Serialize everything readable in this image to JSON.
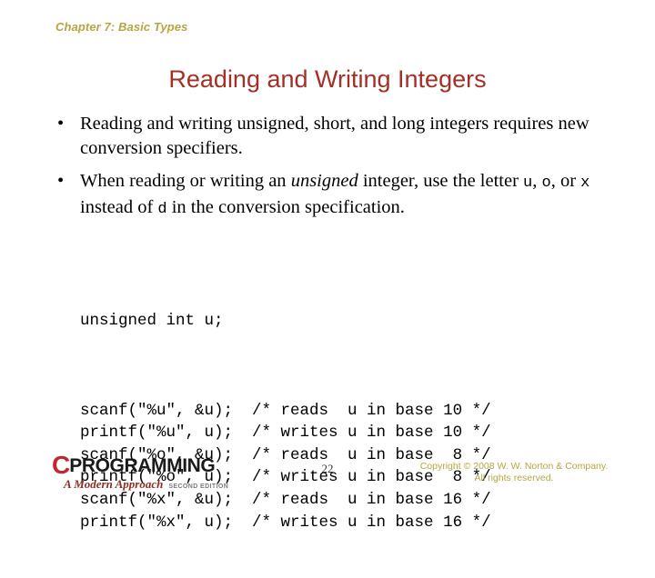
{
  "slide": {
    "chapter_header": "Chapter 7: Basic Types",
    "title": "Reading and Writing Integers",
    "bullet_marker": "•",
    "bullets": [
      {
        "parts": [
          {
            "kind": "text",
            "value": "Reading and writing unsigned, short, and long integers requires new conversion specifiers."
          }
        ]
      },
      {
        "parts": [
          {
            "kind": "text",
            "value": "When reading or writing an "
          },
          {
            "kind": "italic",
            "value": "unsigned"
          },
          {
            "kind": "text",
            "value": " integer, use the letter "
          },
          {
            "kind": "code",
            "value": "u"
          },
          {
            "kind": "text",
            "value": ", "
          },
          {
            "kind": "code",
            "value": "o"
          },
          {
            "kind": "text",
            "value": ", or "
          },
          {
            "kind": "code",
            "value": "x"
          },
          {
            "kind": "text",
            "value": " instead of "
          },
          {
            "kind": "code",
            "value": "d"
          },
          {
            "kind": "text",
            "value": " in the conversion specification."
          }
        ]
      }
    ],
    "code": {
      "declaration": "unsigned int u;",
      "lines": [
        "scanf(\"%u\", &u);  /* reads  u in base 10 */",
        "printf(\"%u\", u);  /* writes u in base 10 */",
        "scanf(\"%o\", &u);  /* reads  u in base  8 */",
        "printf(\"%o\", u);  /* writes u in base  8 */",
        "scanf(\"%x\", &u);  /* reads  u in base 16 */",
        "printf(\"%x\", u);  /* writes u in base 16 */"
      ]
    }
  },
  "footer": {
    "logo": {
      "letter": "C",
      "word": "PROGRAMMING",
      "subtitle": "A Modern Approach",
      "edition": "SECOND EDITION"
    },
    "page_number": "22",
    "copyright_line1": "Copyright © 2008 W. W. Norton & Company.",
    "copyright_line2": "All rights reserved."
  },
  "colors": {
    "chapter_header": "#b5a642",
    "title": "#a33027",
    "body_text": "#000000",
    "logo_c": "#c1272d",
    "logo_subtitle": "#8e2b24",
    "copyright": "#b5a642",
    "background": "#ffffff"
  }
}
